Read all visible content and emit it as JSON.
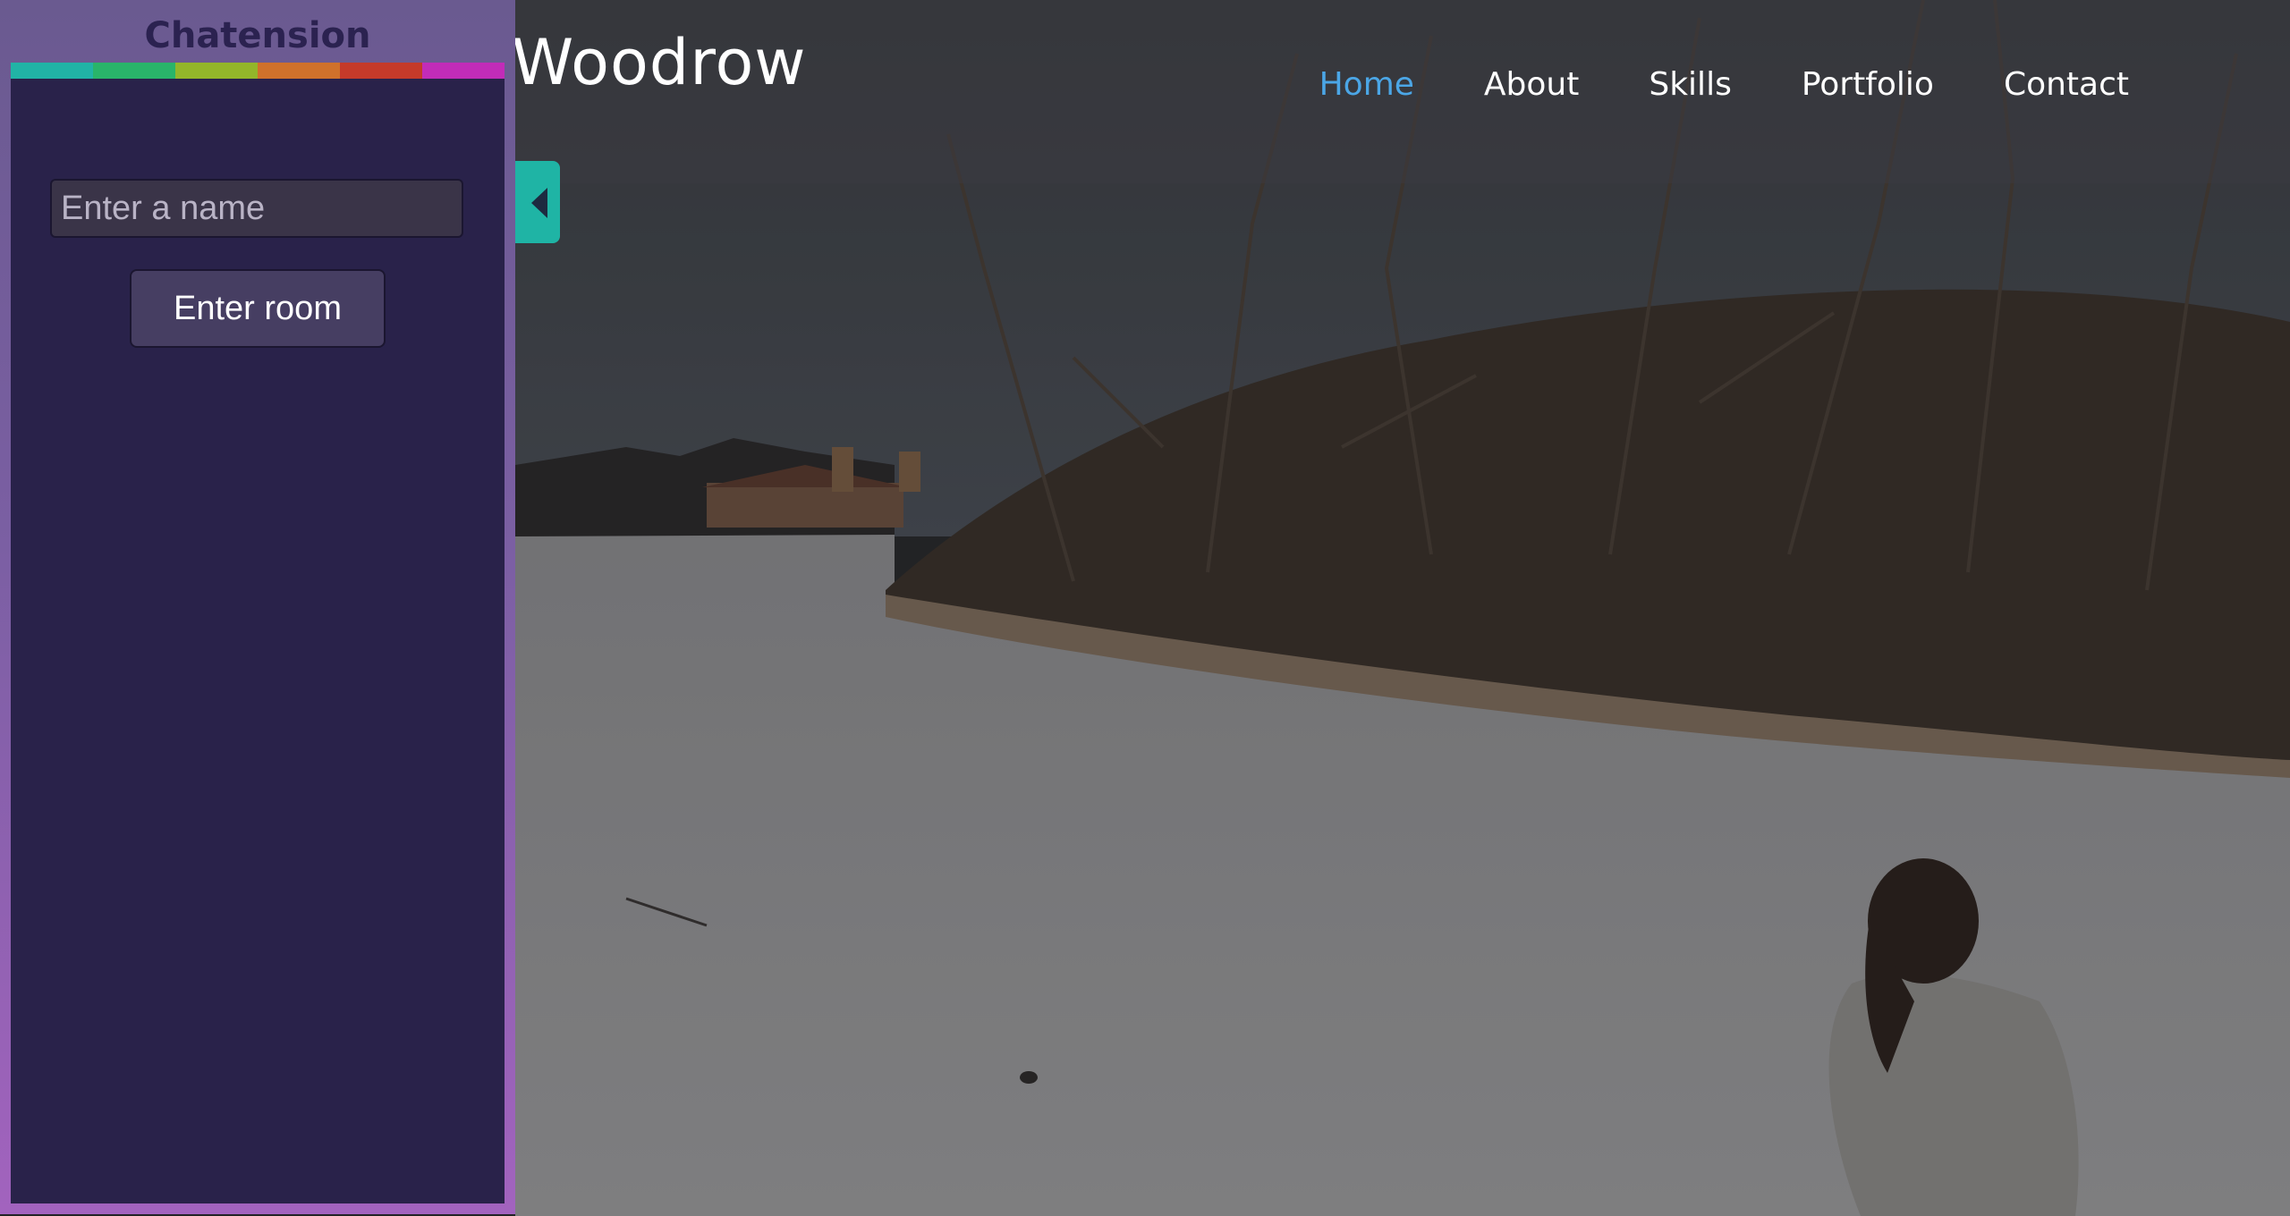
{
  "site": {
    "title": "Woodrow",
    "nav": [
      {
        "label": "Home",
        "active": true
      },
      {
        "label": "About"
      },
      {
        "label": "Skills"
      },
      {
        "label": "Portfolio"
      },
      {
        "label": "Contact"
      }
    ],
    "nav_active_color": "#4ba6e6"
  },
  "chat": {
    "title": "Chatension",
    "name_placeholder": "Enter a name",
    "name_value": "",
    "enter_label": "Enter room",
    "color_bar": [
      "#21b3a6",
      "#29b46a",
      "#93b62a",
      "#d0712b",
      "#c53a2a",
      "#c22cb8"
    ],
    "toggle_icon": "chevron-left-icon",
    "accent": "#1fb4a5"
  }
}
